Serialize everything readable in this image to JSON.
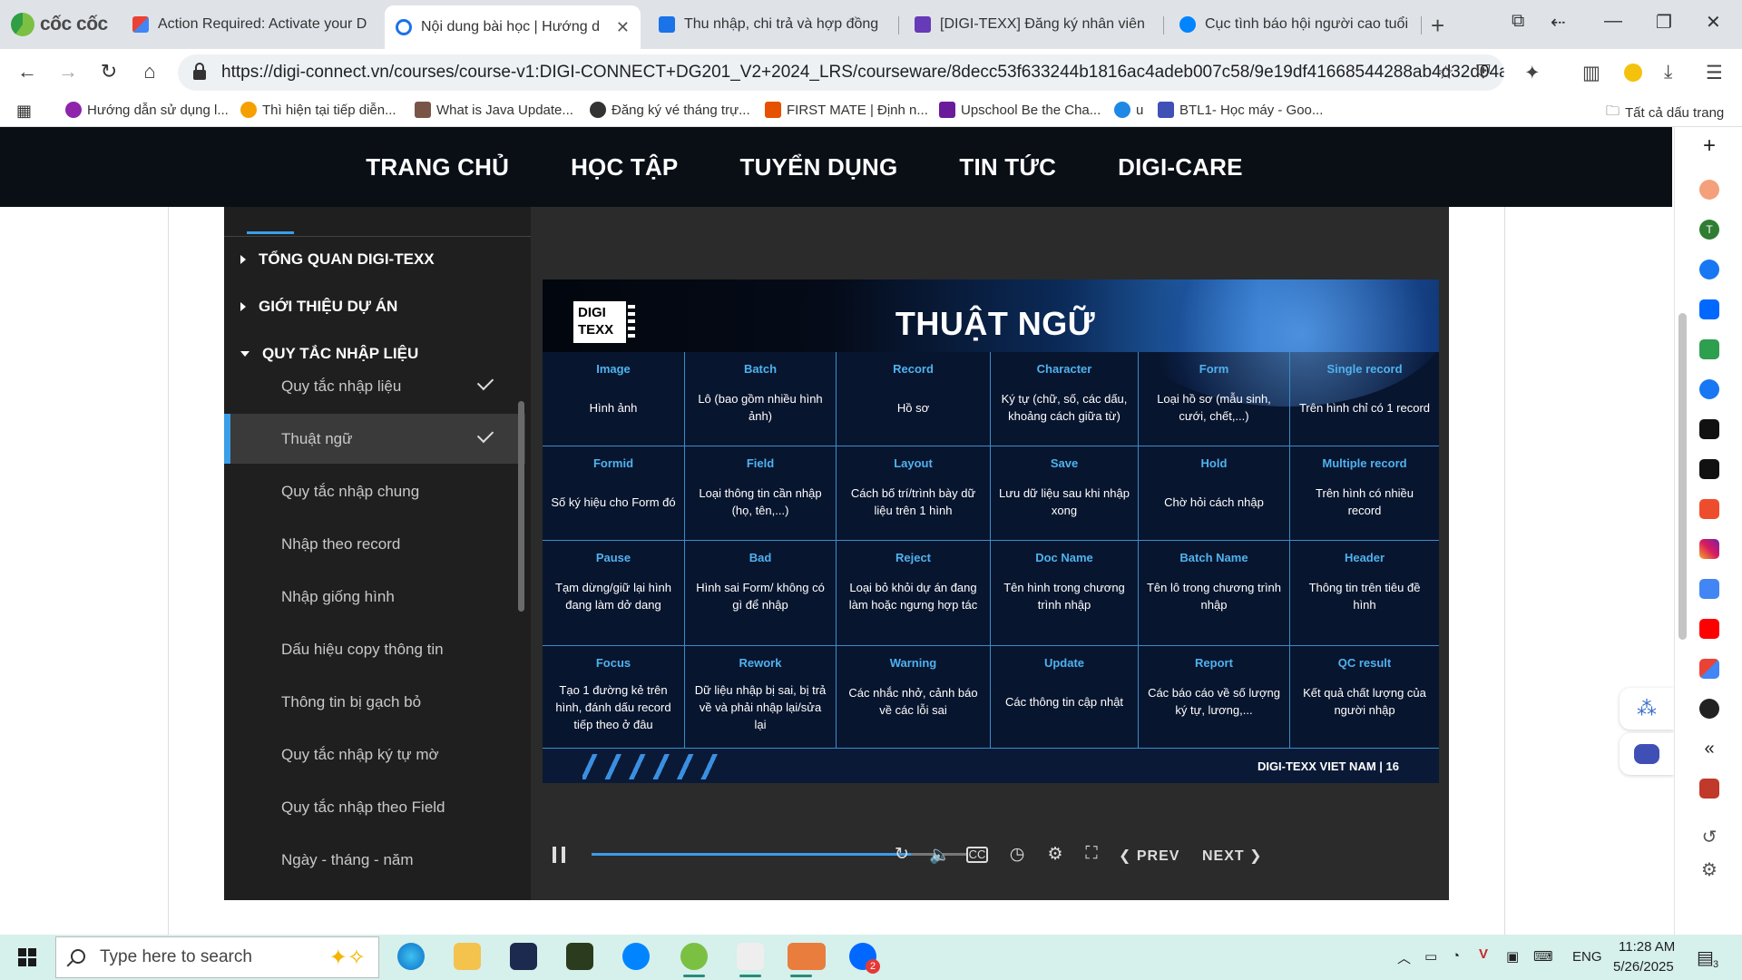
{
  "browser": {
    "brand": "cốc cốc",
    "tabs": [
      {
        "title": "Action Required: Activate your D",
        "color": "#d93025"
      },
      {
        "title": "Nội dung bài học | Hướng d",
        "color": "#1a73e8",
        "active": true
      },
      {
        "title": "Thu nhập, chi trả và hợp đồng | [",
        "color": "#1a73e8"
      },
      {
        "title": "[DIGI-TEXX] Đăng ký nhân viên n",
        "color": "#673ab7"
      },
      {
        "title": "Cục tình báo hội người cao tuổi",
        "color": "#0084ff"
      }
    ],
    "url": "https://digi-connect.vn/courses/course-v1:DIGI-CONNECT+DG201_V2+2024_LRS/courseware/8decc53f633244b1816ac4adeb007c58/9e19df41668544288ab4d32d04a9e0d...",
    "bookmarks": [
      {
        "label": "Hướng dẫn sử dụng l...",
        "color": "#8e24aa"
      },
      {
        "label": "Thì hiện tại tiếp diễn...",
        "color": "#f6a000"
      },
      {
        "label": "What is Java Update...",
        "color": "#795548"
      },
      {
        "label": "Đăng ký vé tháng trự...",
        "color": "#333333"
      },
      {
        "label": "FIRST MATE | Định n...",
        "color": "#e65100"
      },
      {
        "label": "Upschool Be the Cha...",
        "color": "#6a1b9a"
      },
      {
        "label": "u",
        "color": "#1e88e5"
      },
      {
        "label": "BTL1- Học máy - Goo...",
        "color": "#3f51b5"
      }
    ],
    "bookmarks_all": "Tất cả dấu trang"
  },
  "site_nav": [
    "TRANG CHỦ",
    "HỌC TẬP",
    "TUYỂN DỤNG",
    "TIN TỨC",
    "DIGI-CARE"
  ],
  "sidebar": {
    "sections": [
      {
        "label": "TỔNG QUAN DIGI-TEXX",
        "expanded": false
      },
      {
        "label": "GIỚI THIỆU DỰ ÁN",
        "expanded": false
      },
      {
        "label": "QUY TẮC NHẬP LIỆU",
        "expanded": true
      }
    ],
    "lessons": [
      {
        "label": "Quy tắc nhập liệu",
        "done": true
      },
      {
        "label": "Thuật ngữ",
        "done": true,
        "active": true
      },
      {
        "label": "Quy tắc nhập chung"
      },
      {
        "label": "Nhập theo record"
      },
      {
        "label": "Nhập giống hình"
      },
      {
        "label": "Dấu hiệu copy thông tin"
      },
      {
        "label": "Thông tin bị gạch bỏ"
      },
      {
        "label": "Quy tắc nhập ký tự mờ"
      },
      {
        "label": "Quy tắc nhập theo Field"
      },
      {
        "label": "Ngày - tháng - năm"
      }
    ]
  },
  "slide": {
    "logo_line1": "DIGI",
    "logo_line2": "TEXX",
    "title": "THUẬT NGỮ",
    "terms": [
      {
        "term": "Image",
        "def": "Hình ảnh"
      },
      {
        "term": "Batch",
        "def": "Lô (bao gồm nhiều hình ảnh)"
      },
      {
        "term": "Record",
        "def": "Hồ sơ"
      },
      {
        "term": "Character",
        "def": "Ký tự (chữ, số, các dấu, khoảng cách giữa từ)"
      },
      {
        "term": "Form",
        "def": "Loại hồ sơ (mẫu sinh, cưới, chết,...)"
      },
      {
        "term": "Single record",
        "def": "Trên hình chỉ có 1 record"
      },
      {
        "term": "Formid",
        "def": "Số ký hiệu cho Form đó"
      },
      {
        "term": "Field",
        "def": "Loại thông tin cần nhập (họ, tên,...)"
      },
      {
        "term": "Layout",
        "def": "Cách bố trí/trình bày dữ liệu trên 1 hình"
      },
      {
        "term": "Save",
        "def": "Lưu dữ liệu sau khi nhập xong"
      },
      {
        "term": "Hold",
        "def": "Chờ hỏi cách nhập"
      },
      {
        "term": "Multiple record",
        "def": "Trên hình có nhiều record"
      },
      {
        "term": "Pause",
        "def": "Tạm dừng/giữ lại hình đang làm dở dang"
      },
      {
        "term": "Bad",
        "def": "Hình sai Form/ không có gì để nhập"
      },
      {
        "term": "Reject",
        "def": "Loại bỏ khỏi dự án đang làm hoặc ngưng hợp tác"
      },
      {
        "term": "Doc Name",
        "def": "Tên hình trong chương trình nhập"
      },
      {
        "term": "Batch Name",
        "def": "Tên lô trong chương trình nhập"
      },
      {
        "term": "Header",
        "def": "Thông tin trên tiêu đề hình"
      },
      {
        "term": "Focus",
        "def": "Tạo 1 đường kẻ trên hình, đánh dấu record tiếp theo ở đâu"
      },
      {
        "term": "Rework",
        "def": "Dữ liệu nhập bị sai, bị trả về và phải nhập lại/sửa lại"
      },
      {
        "term": "Warning",
        "def": "Các nhắc nhở, cảnh báo về các lỗi sai"
      },
      {
        "term": "Update",
        "def": "Các thông tin cập nhật"
      },
      {
        "term": "Report",
        "def": "Các báo cáo về số lượng ký tự, lương,..."
      },
      {
        "term": "QC result",
        "def": "Kết quả chất lượng của người nhập"
      }
    ],
    "footer": "DIGI-TEXX VIET NAM  |  16"
  },
  "player": {
    "progress_fraction": 0.85,
    "prev_label": "PREV",
    "next_label": "NEXT",
    "accent": "#3a9ee8"
  },
  "taskbar": {
    "search_placeholder": "Type here to search",
    "lang": "ENG",
    "time": "11:28 AM",
    "date": "5/26/2025",
    "notif_count": "3",
    "badge": "2"
  }
}
